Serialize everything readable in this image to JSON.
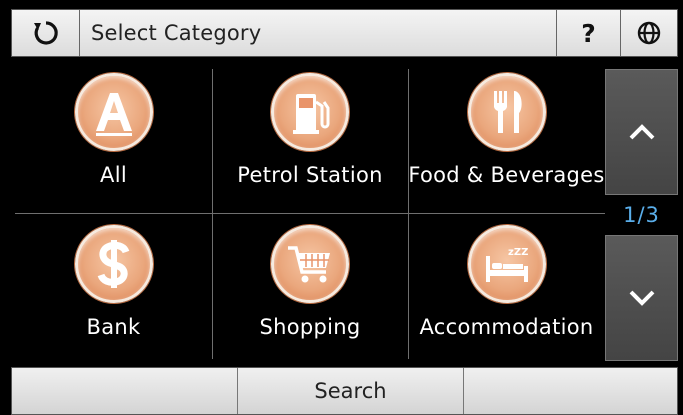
{
  "header": {
    "title": "Select Category",
    "back_icon": "refresh-back-icon",
    "help_label": "?",
    "lang_icon": "globe-icon"
  },
  "categories": [
    {
      "label": "All",
      "icon": "letter-a-icon"
    },
    {
      "label": "Petrol Station",
      "icon": "fuel-pump-icon"
    },
    {
      "label": "Food & Beverages",
      "icon": "fork-knife-icon"
    },
    {
      "label": "Bank",
      "icon": "dollar-icon"
    },
    {
      "label": "Shopping",
      "icon": "cart-icon"
    },
    {
      "label": "Accommodation",
      "icon": "bed-icon"
    }
  ],
  "pagination": {
    "indicator": "1/3",
    "up_icon": "chevron-up-icon",
    "down_icon": "chevron-down-icon"
  },
  "bottom_bar": {
    "left_label": "",
    "search_label": "Search",
    "right_label": ""
  },
  "colors": {
    "icon_orange": "#eaa77d",
    "page_indicator": "#5aaeea",
    "background": "#000000"
  }
}
